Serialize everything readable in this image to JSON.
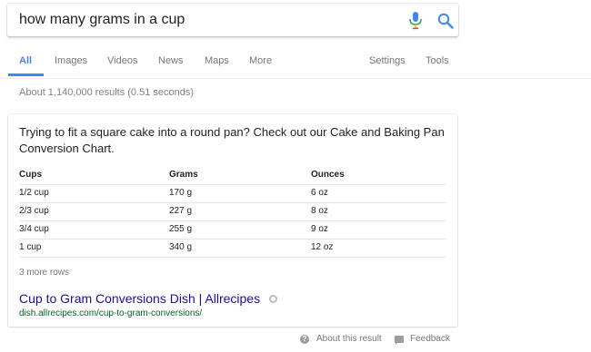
{
  "search": {
    "query": "how many grams in a cup"
  },
  "tabs": [
    {
      "label": "All"
    },
    {
      "label": "Images"
    },
    {
      "label": "Videos"
    },
    {
      "label": "News"
    },
    {
      "label": "Maps"
    },
    {
      "label": "More"
    },
    {
      "label": "Settings"
    },
    {
      "label": "Tools"
    }
  ],
  "stats": "About 1,140,000 results (0.51 seconds)",
  "snippet": {
    "lead": "Trying to fit a square cake into a round pan? Check out our Cake and Baking Pan Conversion Chart.",
    "table": {
      "headers": [
        "Cups",
        "Grams",
        "Ounces"
      ],
      "rows": [
        [
          "1/2 cup",
          "170 g",
          "6 oz"
        ],
        [
          "2/3 cup",
          "227 g",
          "8 oz"
        ],
        [
          "3/4 cup",
          "255 g",
          "9 oz"
        ],
        [
          "1 cup",
          "340 g",
          "12 oz"
        ]
      ]
    },
    "more_rows": "3 more rows",
    "result_title": "Cup to Gram Conversions Dish | Allrecipes",
    "result_url": "dish.allrecipes.com/cup-to-gram-conversions/"
  },
  "footer": {
    "about": "About this result",
    "feedback": "Feedback"
  },
  "colors": {
    "accent": "#4285f4",
    "link": "#1a0dab",
    "url": "#006621",
    "muted": "#777777"
  },
  "icons": {
    "mic": "microphone-icon",
    "search": "search-icon",
    "help": "help-icon",
    "feedback": "feedback-icon"
  }
}
